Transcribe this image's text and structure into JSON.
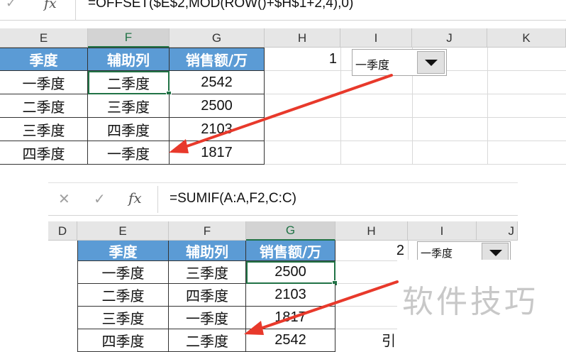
{
  "top": {
    "formula_bar": {
      "check_icon": "✓",
      "fx_label": "fx",
      "formula": "=OFFSET($E$2,MOD(ROW()+$H$1+2,4),0)"
    },
    "columns": [
      "E",
      "F",
      "G",
      "H",
      "I",
      "J",
      "K"
    ],
    "selected_column": "F",
    "table_header": [
      "季度",
      "辅助列",
      "销售额/万"
    ],
    "rows": [
      [
        "一季度",
        "二季度",
        "2542"
      ],
      [
        "二季度",
        "三季度",
        "2500"
      ],
      [
        "三季度",
        "四季度",
        "2103"
      ],
      [
        "四季度",
        "一季度",
        "1817"
      ]
    ],
    "h1_value": "1",
    "dropdown_value": "一季度"
  },
  "bottom": {
    "formula_bar": {
      "cancel_icon": "✕",
      "check_icon": "✓",
      "fx_label": "fx",
      "formula": "=SUMIF(A:A,F2,C:C)"
    },
    "columns": [
      "D",
      "E",
      "F",
      "G",
      "H",
      "I",
      "J"
    ],
    "selected_column": "G",
    "table_header": [
      "季度",
      "辅助列",
      "销售额/万"
    ],
    "rows": [
      [
        "一季度",
        "三季度",
        "2500"
      ],
      [
        "二季度",
        "四季度",
        "2103"
      ],
      [
        "三季度",
        "一季度",
        "1817"
      ],
      [
        "四季度",
        "二季度",
        "2542"
      ]
    ],
    "h1_value": "2",
    "dropdown_value": "一季度",
    "partial_text": "引"
  },
  "watermark": "软件技巧",
  "colors": {
    "header_fill": "#5b9bd5",
    "excel_green": "#217346",
    "arrow_red": "#e8392b"
  }
}
